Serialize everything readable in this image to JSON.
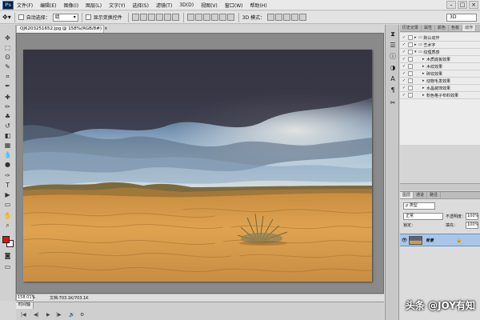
{
  "app": {
    "logo": "Ps",
    "menu": [
      "文件(F)",
      "编辑(E)",
      "图像(I)",
      "图层(L)",
      "文字(Y)",
      "选择(S)",
      "滤镜(T)",
      "3D(D)",
      "视图(V)",
      "窗口(W)",
      "帮助(H)"
    ],
    "window_controls": [
      "–",
      "□",
      "×"
    ]
  },
  "options_bar": {
    "auto_select_label": "自动选择：",
    "auto_select_value": "组",
    "show_transform_label": "显示变换控件",
    "mode_3d_label": "3D 模式：",
    "mode_3d_value": "3D"
  },
  "tools": {
    "icons": [
      "move-icon",
      "marquee-icon",
      "lasso-icon",
      "quick-select-icon",
      "crop-icon",
      "eyedropper-icon",
      "healing-icon",
      "brush-icon",
      "stamp-icon",
      "history-brush-icon",
      "eraser-icon",
      "gradient-icon",
      "blur-icon",
      "dodge-icon",
      "pen-icon",
      "type-icon",
      "path-select-icon",
      "shape-icon",
      "hand-icon",
      "zoom-icon"
    ],
    "glyphs": [
      "✥",
      "⬚",
      "ʘ",
      "✎",
      "⌗",
      "✒",
      "✚",
      "✏",
      "♣",
      "↺",
      "◧",
      "▦",
      "💧",
      "●",
      "✑",
      "T",
      "▶",
      "▭",
      "✋",
      "⌕"
    ],
    "fg_color": "#e01010",
    "bg_color": "#ffffff"
  },
  "document": {
    "tab_title": "QJ6203251652.jpg @ 158%(RGB/8#)",
    "tab_close": "×",
    "zoom": "158.01%",
    "doc_size": "文档:703.1K/703.1K"
  },
  "timeline": {
    "tab_label": "时间轴",
    "controls": [
      "|◀",
      "◀|",
      "▶",
      "|▶",
      "🔊",
      "⚙"
    ]
  },
  "dock": {
    "icons": [
      "history-icon",
      "properties-icon",
      "info-icon",
      "color-icon",
      "char-icon",
      "paragraph-icon",
      "tool-preset-icon"
    ],
    "glyphs": [
      "⧗",
      "☰",
      "ⓘ",
      "◑",
      "A",
      "¶",
      "✂"
    ]
  },
  "actions_panel": {
    "tabs": [
      "历史记录",
      "属性",
      "颜色",
      "色板",
      "动作"
    ],
    "active_tab": 4,
    "rows": [
      {
        "label": "默认动作",
        "indent": 0,
        "folder": true
      },
      {
        "label": "艺术字",
        "indent": 0,
        "folder": true
      },
      {
        "label": "纹理质感",
        "indent": 0,
        "folder": true,
        "open": true
      },
      {
        "label": "木质底板效果",
        "indent": 1
      },
      {
        "label": "木纹效果",
        "indent": 1
      },
      {
        "label": "砖纹效果",
        "indent": 1
      },
      {
        "label": "动物毛发效果",
        "indent": 1
      },
      {
        "label": "水晶装饰效果",
        "indent": 1
      },
      {
        "label": "粉色格子布料效果",
        "indent": 1
      }
    ]
  },
  "layers_panel": {
    "tabs": [
      "图层",
      "通道",
      "路径"
    ],
    "active_tab": 0,
    "filter_label": "ρ 类型",
    "blend_mode": "正常",
    "opacity_label": "不透明度：",
    "opacity_value": "100%",
    "lock_label": "锁定：",
    "fill_label": "填充：",
    "fill_value": "100%",
    "layer_name": "背景",
    "visible_icon": "eye-icon",
    "lock_icon": "lock-icon"
  },
  "watermark": "头条 @JOY有知"
}
